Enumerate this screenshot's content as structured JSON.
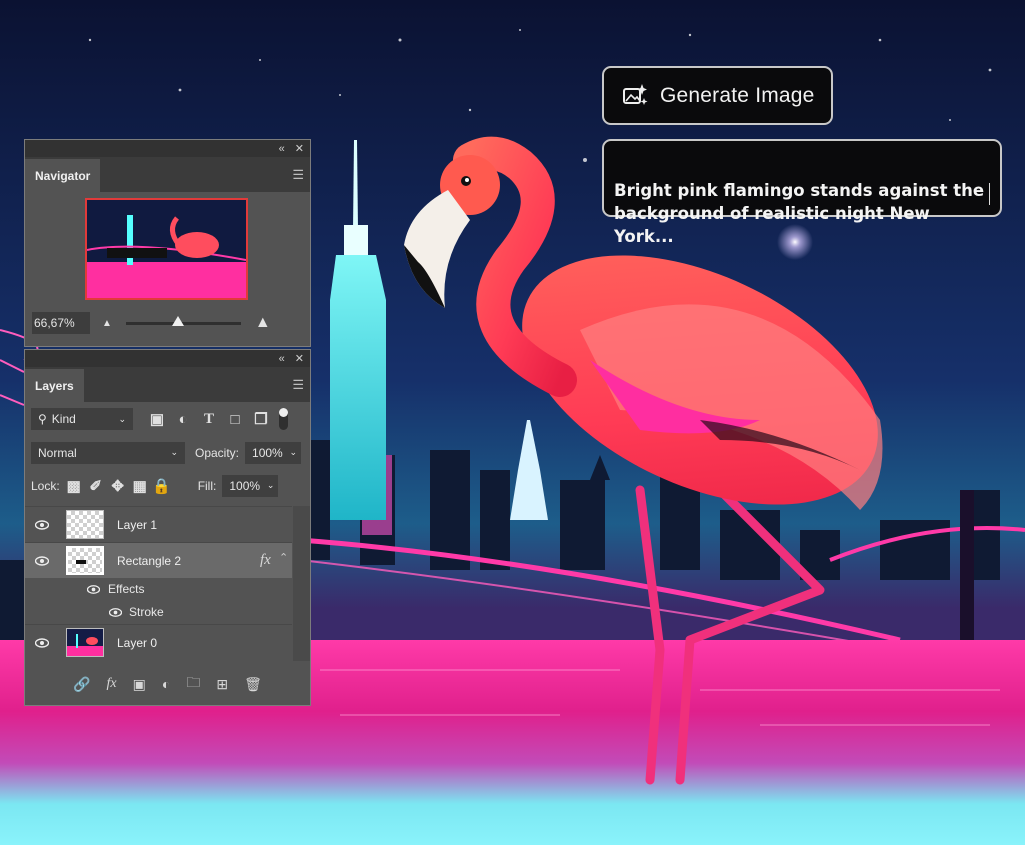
{
  "generate": {
    "button_label": "Generate Image",
    "icon": "ai-image-generate-icon",
    "prompt_text": "Bright pink flamingo stands against the\nbackground of realistic night New York..."
  },
  "navigator": {
    "tab": "Navigator",
    "zoom": "66,67%"
  },
  "layers_panel": {
    "tab": "Layers",
    "filter_label": "Kind",
    "blend_mode": "Normal",
    "opacity_label": "Opacity:",
    "opacity_value": "100%",
    "lock_label": "Lock:",
    "fill_label": "Fill:",
    "fill_value": "100%",
    "layers": [
      {
        "name": "Layer 1"
      },
      {
        "name": "Rectangle 2",
        "fx": "fx"
      },
      {
        "name": "Layer 0"
      }
    ],
    "effects_label": "Effects",
    "stroke_label": "Stroke"
  },
  "colors": {
    "neon_pink": "#ff2d95",
    "flamingo": "#ff4d5e",
    "cyan": "#3fe6e8",
    "panel_bg": "#535353"
  }
}
